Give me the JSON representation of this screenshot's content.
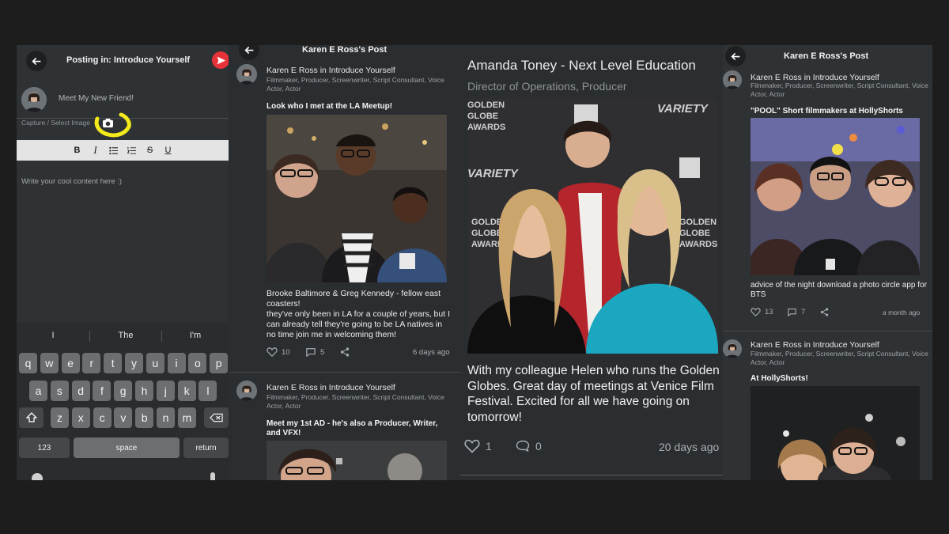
{
  "composer": {
    "title": "Posting in: Introduce Yourself",
    "post_title_placeholder": "Meet My New Friend!",
    "capture_label": "Capture / Select Image",
    "content_placeholder": "Write your cool content here :)",
    "toolbar": [
      "B",
      "I",
      "bulleted-list",
      "numbered-list",
      "S",
      "U"
    ],
    "suggestions": [
      "I",
      "The",
      "I'm"
    ],
    "keyboard": {
      "row1": [
        "q",
        "w",
        "e",
        "r",
        "t",
        "y",
        "u",
        "i",
        "o",
        "p"
      ],
      "row2": [
        "a",
        "s",
        "d",
        "f",
        "g",
        "h",
        "j",
        "k",
        "l"
      ],
      "row3": [
        "z",
        "x",
        "c",
        "v",
        "b",
        "n",
        "m"
      ],
      "numbers_key": "123",
      "space_key": "space",
      "return_key": "return"
    }
  },
  "feed": {
    "title": "Karen E Ross's Post",
    "post1": {
      "author": "Karen E Ross in Introduce Yourself",
      "roles": "Filmmaker, Producer, Screenwriter, Script Consultant, Voice Actor, Actor",
      "title": "Look who I met at the LA Meetup!",
      "body": "Brooke Baltimore & Greg Kennedy - fellow east coasters!\nthey've only been in LA for a couple of years, but I can already tell they're going to be LA natives in no time join me in welcoming them!",
      "likes": "10",
      "comments": "5",
      "time": "6 days ago"
    },
    "post2": {
      "author": "Karen E Ross in Introduce Yourself",
      "roles": "Filmmaker, Producer, Screenwriter, Script Consultant, Voice Actor, Actor",
      "title": "Meet my 1st AD - he's also a Producer, Writer, and VFX!"
    }
  },
  "featured": {
    "name": "Amanda Toney - Next Level Education",
    "role": "Director of Operations, Producer",
    "caption": "With my colleague Helen who runs the Golden Globes. Great day of meetings at Venice Film Festival. Excited for all we have going on tomorrow!",
    "likes": "1",
    "comments": "0",
    "time": "20 days ago",
    "backdrop_words": [
      "GOLDEN",
      "GLOBE",
      "AWARDS",
      "VARIETY"
    ]
  },
  "right": {
    "title": "Karen E Ross's Post",
    "post1": {
      "roles": "Filmmaker, Producer, Screenwriter, Script Consultant, Voice Actor, Actor",
      "title": "\"POOL\" Short filmmakers at HollyShorts",
      "body": "advice of the night download a photo circle app for BTS",
      "likes": "13",
      "comments": "7",
      "time": "a month ago"
    },
    "post2": {
      "author": "Karen E Ross in Introduce Yourself",
      "roles": "Filmmaker, Producer, Screenwriter, Script Consultant, Voice Actor, Actor",
      "title": "At HollyShorts!"
    }
  },
  "colors": {
    "send": "#e8323a",
    "highlight": "#f2ea1c",
    "panel": "#2f3234"
  }
}
